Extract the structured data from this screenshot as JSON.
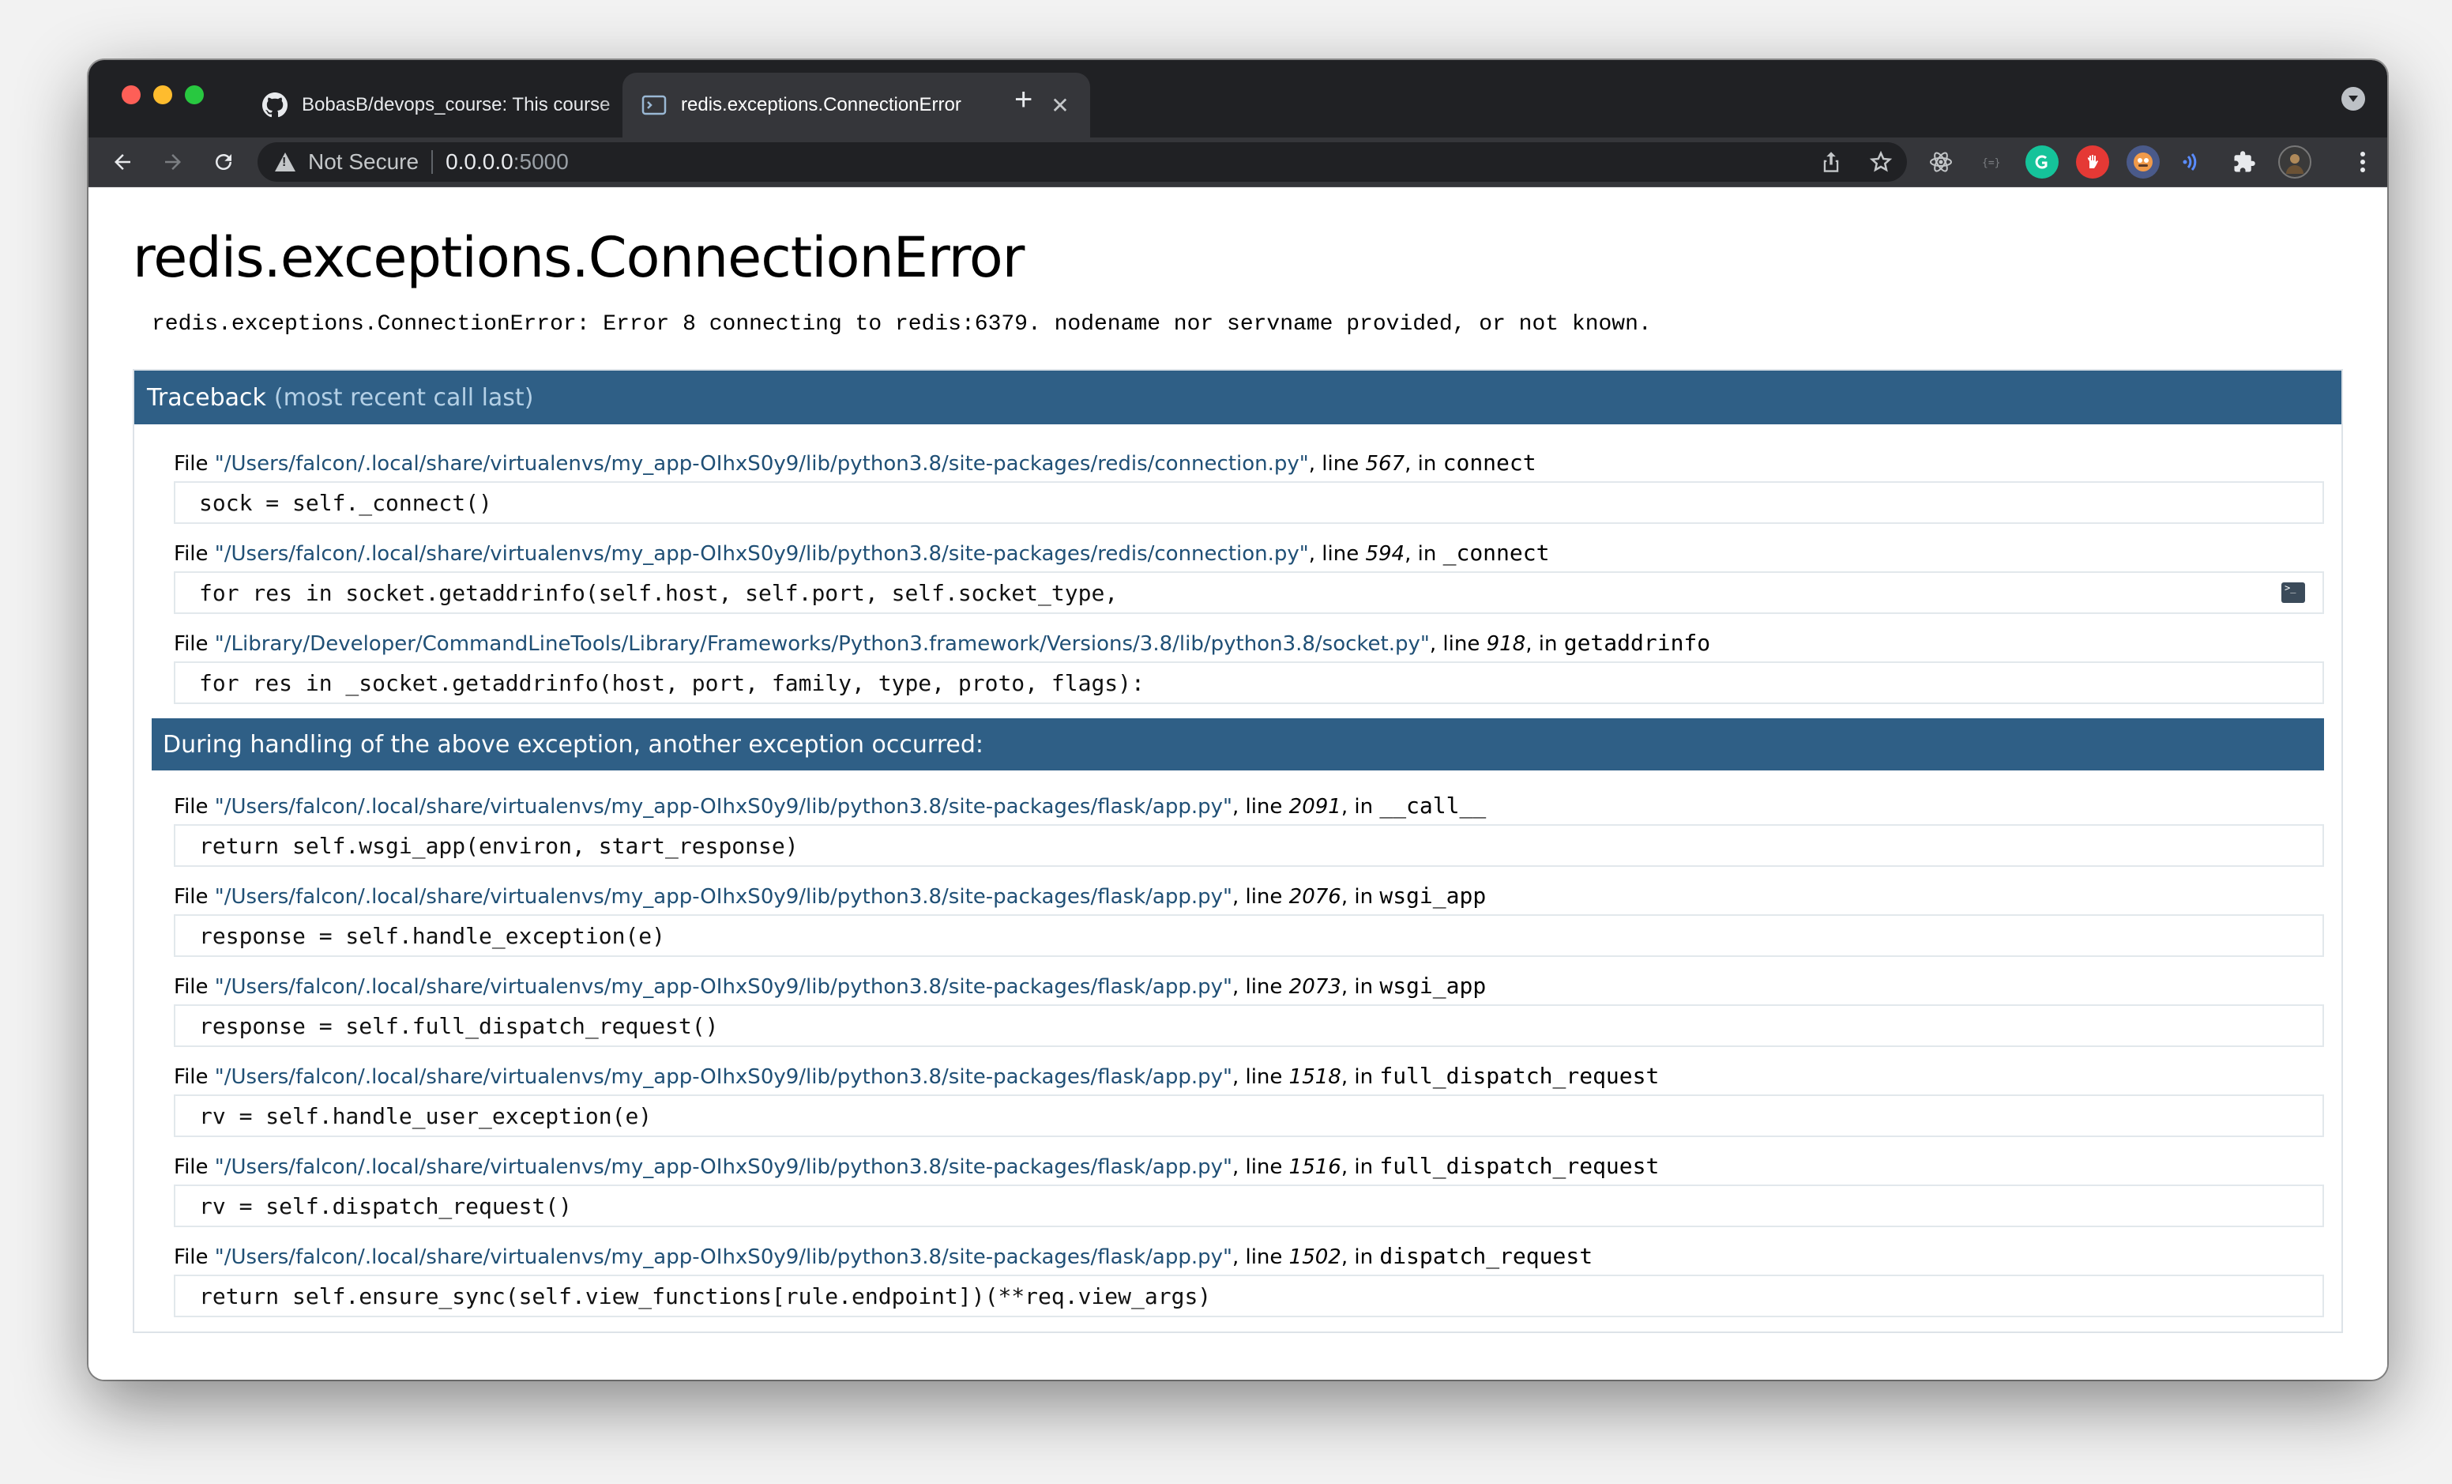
{
  "browser": {
    "tabs": [
      {
        "title": "BobasB/devops_course: This course",
        "active": false
      },
      {
        "title": "redis.exceptions.ConnectionError",
        "active": true
      }
    ],
    "new_tab": "+",
    "close_glyph": "✕",
    "not_secure": "Not Secure",
    "url_host": "0.0.0.0",
    "url_port": ":5000"
  },
  "page": {
    "title": "redis.exceptions.ConnectionError",
    "message": "redis.exceptions.ConnectionError: Error 8 connecting to redis:6379. nodename nor servname provided, or not known.",
    "traceback_label": "Traceback",
    "traceback_sub": "(most recent call last)",
    "frames_before": [
      {
        "path": "\"/Users/falcon/.local/share/virtualenvs/my_app-OIhxS0y9/lib/python3.8/site-packages/redis/connection.py\"",
        "line": "567",
        "func": "connect",
        "code": "sock = self._connect()"
      },
      {
        "path": "\"/Users/falcon/.local/share/virtualenvs/my_app-OIhxS0y9/lib/python3.8/site-packages/redis/connection.py\"",
        "line": "594",
        "func": "_connect",
        "code": "for res in socket.getaddrinfo(self.host, self.port, self.socket_type,"
      },
      {
        "path": "\"/Library/Developer/CommandLineTools/Library/Frameworks/Python3.framework/Versions/3.8/lib/python3.8/socket.py\"",
        "line": "918",
        "func": "getaddrinfo",
        "code": "for res in _socket.getaddrinfo(host, port, family, type, proto, flags):"
      }
    ],
    "divider": "During handling of the above exception, another exception occurred:",
    "frames_after": [
      {
        "path": "\"/Users/falcon/.local/share/virtualenvs/my_app-OIhxS0y9/lib/python3.8/site-packages/flask/app.py\"",
        "line": "2091",
        "func": "__call__",
        "code": "return self.wsgi_app(environ, start_response)"
      },
      {
        "path": "\"/Users/falcon/.local/share/virtualenvs/my_app-OIhxS0y9/lib/python3.8/site-packages/flask/app.py\"",
        "line": "2076",
        "func": "wsgi_app",
        "code": "response = self.handle_exception(e)"
      },
      {
        "path": "\"/Users/falcon/.local/share/virtualenvs/my_app-OIhxS0y9/lib/python3.8/site-packages/flask/app.py\"",
        "line": "2073",
        "func": "wsgi_app",
        "code": "response = self.full_dispatch_request()"
      },
      {
        "path": "\"/Users/falcon/.local/share/virtualenvs/my_app-OIhxS0y9/lib/python3.8/site-packages/flask/app.py\"",
        "line": "1518",
        "func": "full_dispatch_request",
        "code": "rv = self.handle_user_exception(e)"
      },
      {
        "path": "\"/Users/falcon/.local/share/virtualenvs/my_app-OIhxS0y9/lib/python3.8/site-packages/flask/app.py\"",
        "line": "1516",
        "func": "full_dispatch_request",
        "code": "rv = self.dispatch_request()"
      },
      {
        "path": "\"/Users/falcon/.local/share/virtualenvs/my_app-OIhxS0y9/lib/python3.8/site-packages/flask/app.py\"",
        "line": "1502",
        "func": "dispatch_request",
        "code": "return self.ensure_sync(self.view_functions[rule.endpoint])(**req.view_args)"
      }
    ],
    "file_word": "File",
    "line_word": "line",
    "in_word": "in"
  },
  "colors": {
    "header_blue": "#2f5f86",
    "path_blue": "#1f4f75"
  }
}
